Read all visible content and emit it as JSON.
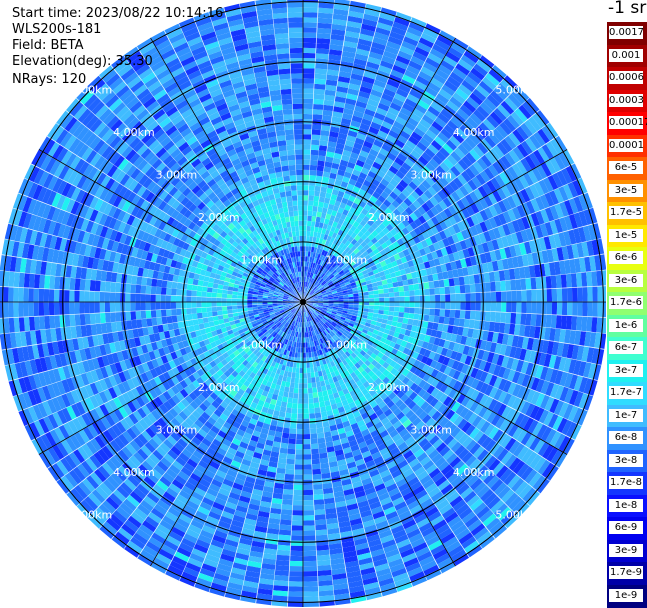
{
  "header": {
    "start_time": "Start time: 2023/08/22 10:14:16",
    "instrument": "WLS200s-181",
    "field": "Field: BETA",
    "elevation": "Elevation(deg): 35.30",
    "nrays": "NRays: 120"
  },
  "colorbar": {
    "unit_label": "-1 sr",
    "colors": [
      "#000080",
      "#0000a8",
      "#0000d0",
      "#0000f0",
      "#0a10ff",
      "#1436ff",
      "#2064ff",
      "#3092ff",
      "#40bcff",
      "#30dcff",
      "#20f0f0",
      "#40ffd0",
      "#60ffa0",
      "#90ff70",
      "#b8ff40",
      "#e8ff10",
      "#ffe800",
      "#ffc000",
      "#ff9000",
      "#ff6000",
      "#ff3000",
      "#ff0000",
      "#e00000",
      "#c00000",
      "#a00000",
      "#800000"
    ],
    "tick_labels": [
      "0.0017",
      "0.001",
      "0.0006",
      "0.0003",
      "0.00017",
      "0.0001",
      "6e-5",
      "3e-5",
      "1.7e-5",
      "1e-5",
      "6e-6",
      "3e-6",
      "1.7e-6",
      "1e-6",
      "6e-7",
      "3e-7",
      "1.7e-7",
      "1e-7",
      "6e-8",
      "3e-8",
      "1.7e-8",
      "1e-8",
      "6e-9",
      "3e-9",
      "1.7e-9",
      "1e-9"
    ]
  },
  "chart_data": {
    "type": "heatmap",
    "projection": "polar PPI scan",
    "field": "BETA",
    "elevation_deg": 35.3,
    "n_rays": 120,
    "range_unit": "km",
    "range_max_km": 5.0,
    "range_rings_km": [
      1.0,
      2.0,
      3.0,
      4.0,
      5.0
    ],
    "ring_labels": [
      "1.00km",
      "2.00km",
      "3.00km",
      "4.00km",
      "5.00km"
    ],
    "value_scale": "log",
    "value_range": [
      1e-09,
      0.0017
    ],
    "typical_values": {
      "near_range_0_1km": "1e-8 to 3e-8",
      "range_1_2km": "6e-8 to 1e-7",
      "range_2_5km": "1e-8 to 6e-8"
    }
  }
}
